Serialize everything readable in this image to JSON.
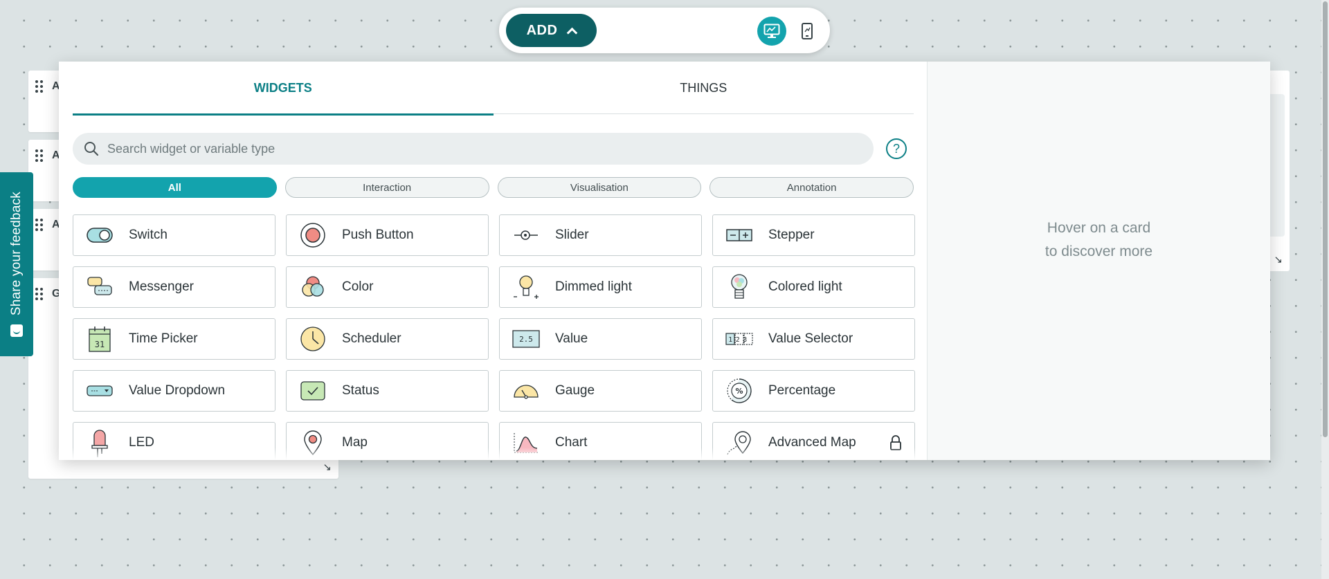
{
  "toolbar": {
    "add_label": "ADD",
    "desktop_icon": "desktop-icon",
    "mobile_icon": "mobile-icon"
  },
  "feedback": {
    "label": "Share your feedback",
    "icon": "feedback-icon"
  },
  "background_cards": [
    {
      "label": "A"
    },
    {
      "label": "A"
    },
    {
      "label": "A"
    },
    {
      "label": "G"
    }
  ],
  "popup": {
    "tabs": [
      {
        "label": "WIDGETS",
        "active": true
      },
      {
        "label": "THINGS",
        "active": false
      }
    ],
    "search": {
      "placeholder": "Search widget or variable type",
      "value": ""
    },
    "help_label": "?",
    "filters": [
      {
        "label": "All",
        "active": true
      },
      {
        "label": "Interaction",
        "active": false
      },
      {
        "label": "Visualisation",
        "active": false
      },
      {
        "label": "Annotation",
        "active": false
      }
    ],
    "widgets": [
      {
        "label": "Switch",
        "icon": "switch-icon"
      },
      {
        "label": "Push Button",
        "icon": "push-button-icon"
      },
      {
        "label": "Slider",
        "icon": "slider-icon"
      },
      {
        "label": "Stepper",
        "icon": "stepper-icon"
      },
      {
        "label": "Messenger",
        "icon": "messenger-icon"
      },
      {
        "label": "Color",
        "icon": "color-icon"
      },
      {
        "label": "Dimmed light",
        "icon": "dimmed-light-icon"
      },
      {
        "label": "Colored light",
        "icon": "colored-light-icon"
      },
      {
        "label": "Time Picker",
        "icon": "time-picker-icon",
        "icon_text": "31"
      },
      {
        "label": "Scheduler",
        "icon": "scheduler-icon"
      },
      {
        "label": "Value",
        "icon": "value-icon",
        "icon_text": "2.5"
      },
      {
        "label": "Value Selector",
        "icon": "value-selector-icon",
        "icon_text": "123"
      },
      {
        "label": "Value Dropdown",
        "icon": "value-dropdown-icon"
      },
      {
        "label": "Status",
        "icon": "status-icon"
      },
      {
        "label": "Gauge",
        "icon": "gauge-icon"
      },
      {
        "label": "Percentage",
        "icon": "percentage-icon",
        "icon_text": "%"
      },
      {
        "label": "LED",
        "icon": "led-icon"
      },
      {
        "label": "Map",
        "icon": "map-icon"
      },
      {
        "label": "Chart",
        "icon": "chart-icon"
      },
      {
        "label": "Advanced Map",
        "icon": "advanced-map-icon",
        "locked": true
      }
    ],
    "hover_text": "Hover on a card\nto discover more"
  },
  "colors": {
    "teal_dark": "#0d5f63",
    "teal": "#0b7f85",
    "teal_bright": "#13a3ad",
    "background": "#dce3e4"
  }
}
